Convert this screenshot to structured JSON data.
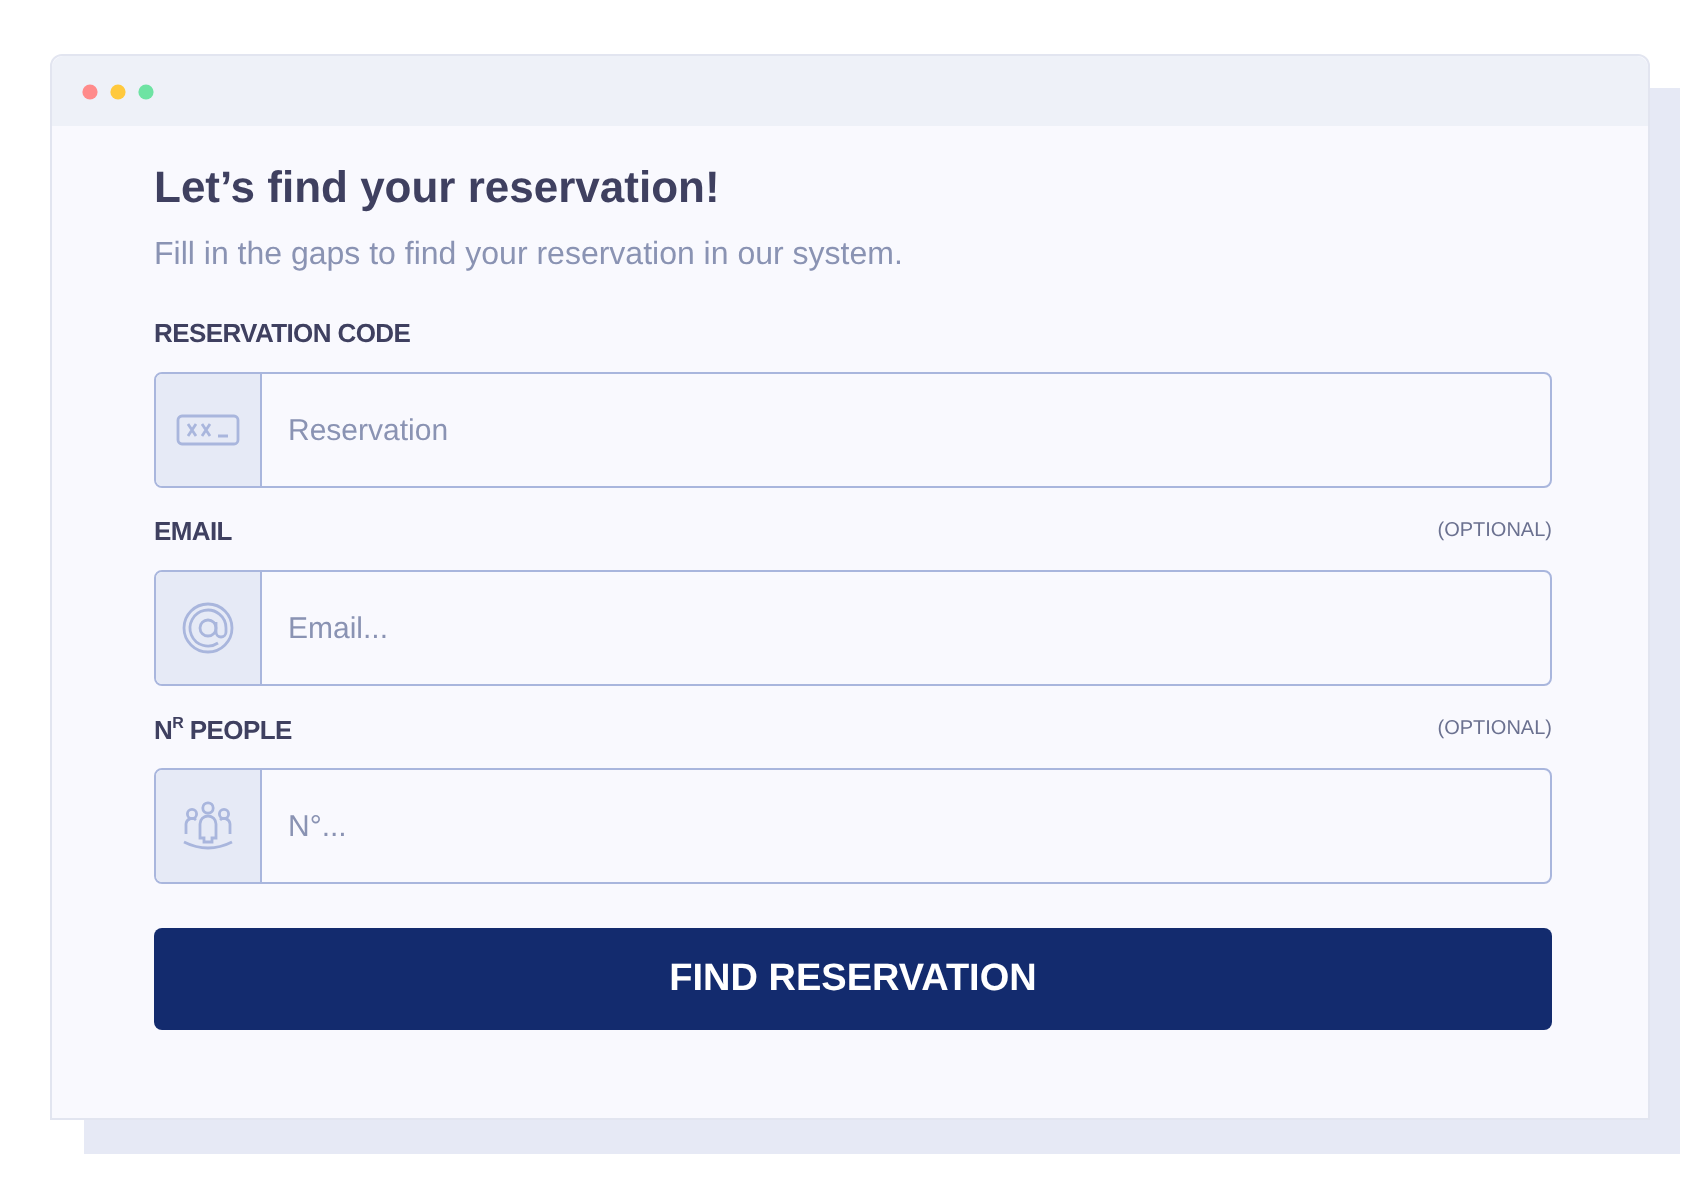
{
  "form": {
    "title": "Let’s find your reservation!",
    "subtitle": "Fill in the gaps to find your reservation in our system.",
    "fields": [
      {
        "kind": "code",
        "label": "RESERVATION CODE",
        "placeholder": "Reservation"
      },
      {
        "kind": "email",
        "label": "EMAIL",
        "optional": "(OPTIONAL)",
        "placeholder": "Email..."
      },
      {
        "kind": "people",
        "label": "N$^{R}$ PEOPLE",
        "optional": "(OPTIONAL)",
        "placeholder": "N°..."
      }
    ],
    "submit": "FIND RESERVATION"
  }
}
